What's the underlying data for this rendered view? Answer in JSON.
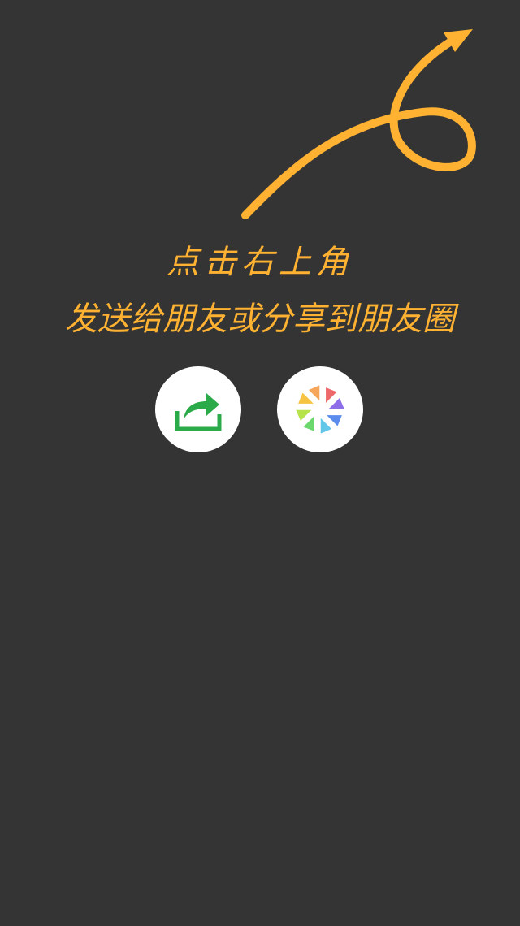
{
  "overlay": {
    "background_color": "#343434",
    "accent_color": "#FFB232",
    "hint": {
      "line1": "点击右上角",
      "line2": "发送给朋友或分享到朋友圈"
    },
    "arrow_icon": "curly-arrow-up-right"
  },
  "buttons": {
    "share": {
      "icon": "share-forward-icon",
      "color": "#2BAA4A"
    },
    "moments": {
      "icon": "moments-aperture-icon",
      "colors": [
        "#F6C343",
        "#F3A55B",
        "#EE6A6A",
        "#8E6DE8",
        "#5C8BEE",
        "#62C7E8",
        "#6BD86E",
        "#B6E24A"
      ]
    }
  }
}
